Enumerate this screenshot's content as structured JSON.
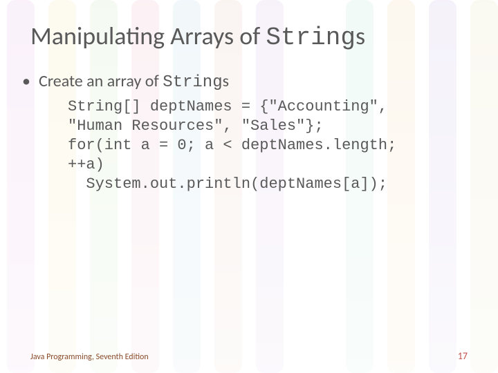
{
  "title": {
    "before": "Manipulating Arrays of ",
    "code": "String",
    "after": "s"
  },
  "bullet": {
    "before": "Create an array of ",
    "code": "String",
    "after": "s"
  },
  "code_lines": [
    "String[] deptNames = {\"Accounting\",",
    "\"Human Resources\", \"Sales\"};",
    "for(int a = 0; a < deptNames.length;",
    "++a)",
    "  System.out.println(deptNames[a]);"
  ],
  "footer": {
    "left": "Java Programming, Seventh Edition",
    "right": "17"
  }
}
